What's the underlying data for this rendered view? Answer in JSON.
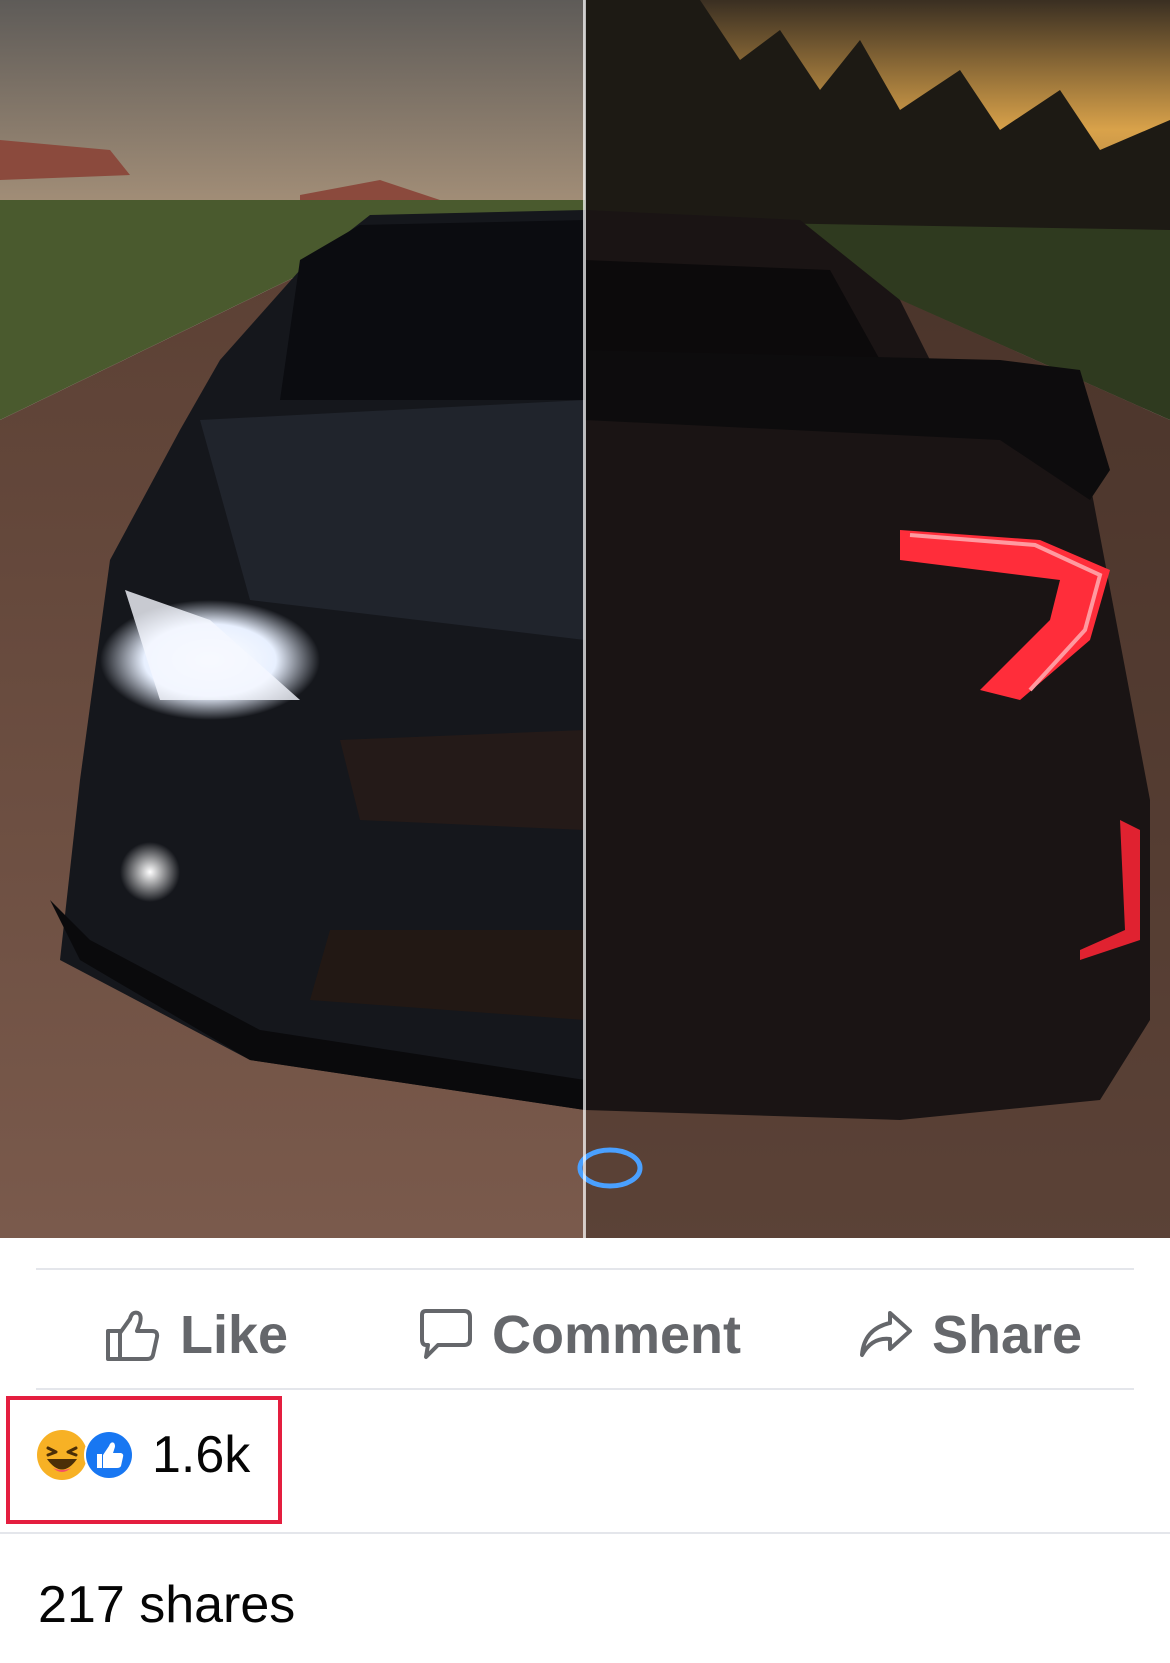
{
  "post": {
    "image_alt": "Honda Civic front and rear split view at dusk",
    "actions": [
      {
        "label": "Like",
        "icon": "thumbs-up-icon"
      },
      {
        "label": "Comment",
        "icon": "speech-bubble-icon"
      },
      {
        "label": "Share",
        "icon": "share-arrow-icon"
      }
    ],
    "reactions": {
      "types": [
        "haha-reaction-icon",
        "like-reaction-icon"
      ],
      "count": "1.6k"
    },
    "shares": "217 shares"
  },
  "colors": {
    "action_text": "#65676b",
    "like_blue": "#1877f2",
    "haha_yellow": "#f7b125",
    "highlight": "#e41e3f"
  }
}
